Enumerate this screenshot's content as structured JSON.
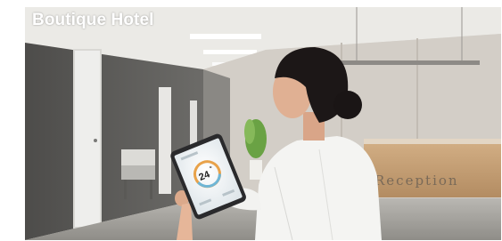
{
  "caption": "Boutique Hotel",
  "scene": {
    "sign_text": "Reception",
    "tablet_temperature": "24",
    "tablet_unit": "°"
  },
  "colors": {
    "left_wall": "#5e5d5b",
    "ceiling": "#e9e8e4",
    "back_wall": "#cfcac3",
    "floor": "#a8a7a3",
    "desk_wood": "#c9a57a",
    "shirt": "#f3f3f1",
    "hair": "#1b1616",
    "tablet": "#2a2a2c",
    "caption_text": "#ffffff"
  }
}
